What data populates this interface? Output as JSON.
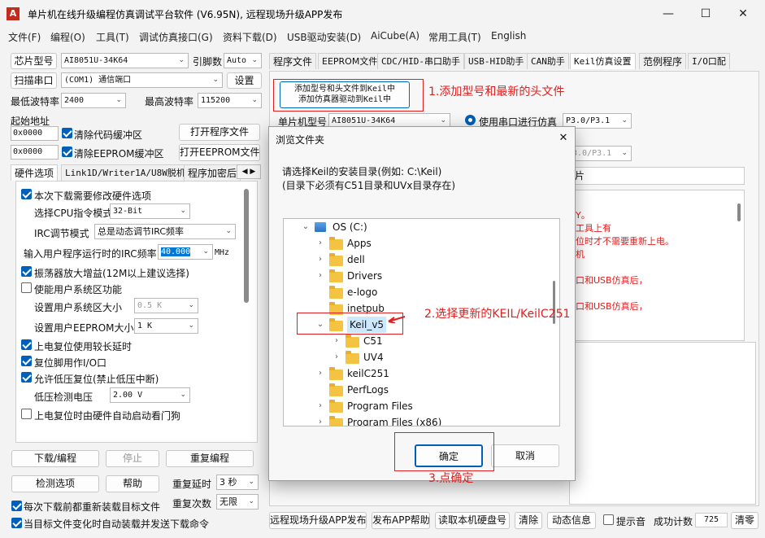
{
  "window": {
    "title": "单片机在线升级编程仿真调试平台软件 (V6.95N), 远程现场升级APP发布",
    "icon": "A",
    "minimize": "—",
    "maximize": "☐",
    "close": "✕"
  },
  "menu": [
    "文件(F)",
    "编程(O)",
    "工具(T)",
    "调试仿真接口(G)",
    "资料下载(D)",
    "USB驱动安装(D)",
    "AiCube(A)",
    "常用工具(T)",
    "English"
  ],
  "left": {
    "chip_label": "芯片型号",
    "chip_value": "AI8051U-34K64",
    "pin_label": "引脚数",
    "pin_value": "Auto",
    "scan_label": "扫描串口",
    "port_value": "(COM1) 通信端口",
    "settings": "设置",
    "min_baud_label": "最低波特率",
    "min_baud": "2400",
    "max_baud_label": "最高波特率",
    "max_baud": "115200",
    "start_addr_label": "起始地址",
    "addr1": "0x0000",
    "addr2": "0x0000",
    "clear_code": "清除代码缓冲区",
    "clear_eeprom": "清除EEPROM缓冲区",
    "open_program": "打开程序文件",
    "open_eeprom": "打开EEPROM文件",
    "tabs": [
      "硬件选项",
      "Link1D/Writer1A/U8W脱机",
      "程序加密后"
    ],
    "hw": {
      "need_modify": "本次下载需要修改硬件选项",
      "cpu_mode_label": "选择CPU指令模式",
      "cpu_mode": "32-Bit",
      "irc_label": "IRC调节模式",
      "irc_mode": "总是动态调节IRC频率",
      "freq_label": "输入用户程序运行时的IRC频率",
      "freq": "40.000",
      "freq_unit": "MHz",
      "osc_gain": "振荡器放大增益(12M以上建议选择)",
      "sys_area": "使能用户系统区功能",
      "sys_size_label": "设置用户系统区大小",
      "sys_size": "0.5 K",
      "eeprom_size_label": "设置用户EEPROM大小",
      "eeprom_size": "1   K",
      "delay": "上电复位使用较长延时",
      "reset_io": "复位脚用作I/O口",
      "lvr": "允许低压复位(禁止低压中断)",
      "lvd_label": "低压检测电压",
      "lvd": "2.00 V",
      "wdt": "上电复位时由硬件自动启动看门狗"
    },
    "download": "下载/编程",
    "stop": "停止",
    "reprogram": "重复编程",
    "check": "检测选项",
    "help": "帮助",
    "repeat_delay_label": "重复延时",
    "repeat_delay": "3 秒",
    "repeat_count_label": "重复次数",
    "repeat_count": "无限",
    "reload": "每次下载前都重新装载目标文件",
    "auto_send": "当目标文件变化时自动装载并发送下载命令"
  },
  "right": {
    "tabs": [
      "程序文件",
      "EEPROM文件",
      "CDC/HID-串口助手",
      "USB-HID助手",
      "CAN助手",
      "Keil仿真设置",
      "范例程序",
      "I/O口配"
    ],
    "add_keil_btn1": "添加型号和头文件到Keil中",
    "add_keil_btn2": "添加仿真器驱动到Keil中",
    "chip_label": "单片机型号",
    "chip_value": "AI8051U-34K64",
    "use_serial": "使用串口进行仿真",
    "port_pair": "P3.0/P3.1",
    "port_pair2": "3.0/P3.1",
    "pian": "片",
    "notes": [
      "Y。",
      "工具上有",
      "位时才不需要重新上电。",
      "机",
      "口和USB仿真后，",
      "口和USB仿真后，"
    ],
    "bottom_btns": [
      "远程现场升级APP发布",
      "发布APP帮助",
      "读取本机硬盘号",
      "清除",
      "动态信息"
    ],
    "beep": "提示音",
    "success_label": "成功计数",
    "success_count": "725",
    "clear": "清零"
  },
  "dialog": {
    "title": "浏览文件夹",
    "close": "✕",
    "prompt1": "请选择Keil的安装目录(例如: C:\\Keil)",
    "prompt2": "(目录下必须有C51目录和UVx目录存在)",
    "tree": [
      {
        "label": "OS (C:)",
        "level": 0,
        "exp": "expanded",
        "kind": "drive"
      },
      {
        "label": "Apps",
        "level": 1,
        "exp": "collapsed"
      },
      {
        "label": "dell",
        "level": 1,
        "exp": "collapsed"
      },
      {
        "label": "Drivers",
        "level": 1,
        "exp": "collapsed"
      },
      {
        "label": "e-logo",
        "level": 1,
        "exp": "none"
      },
      {
        "label": "inetpub",
        "level": 1,
        "exp": "none"
      },
      {
        "label": "Keil_v5",
        "level": 1,
        "exp": "expanded",
        "selected": true
      },
      {
        "label": "C51",
        "level": 2,
        "exp": "collapsed"
      },
      {
        "label": "UV4",
        "level": 2,
        "exp": "collapsed"
      },
      {
        "label": "keilC251",
        "level": 1,
        "exp": "collapsed"
      },
      {
        "label": "PerfLogs",
        "level": 1,
        "exp": "none"
      },
      {
        "label": "Program Files",
        "level": 1,
        "exp": "collapsed"
      },
      {
        "label": "Program Files (x86)",
        "level": 1,
        "exp": "collapsed"
      }
    ],
    "ok": "确定",
    "cancel": "取消"
  },
  "annotations": {
    "a1": "1.添加型号和最新的头文件",
    "a2": "2.选择更新的KEIL/KeilC251",
    "a3": "3.点确定",
    "color": "#e02020"
  }
}
